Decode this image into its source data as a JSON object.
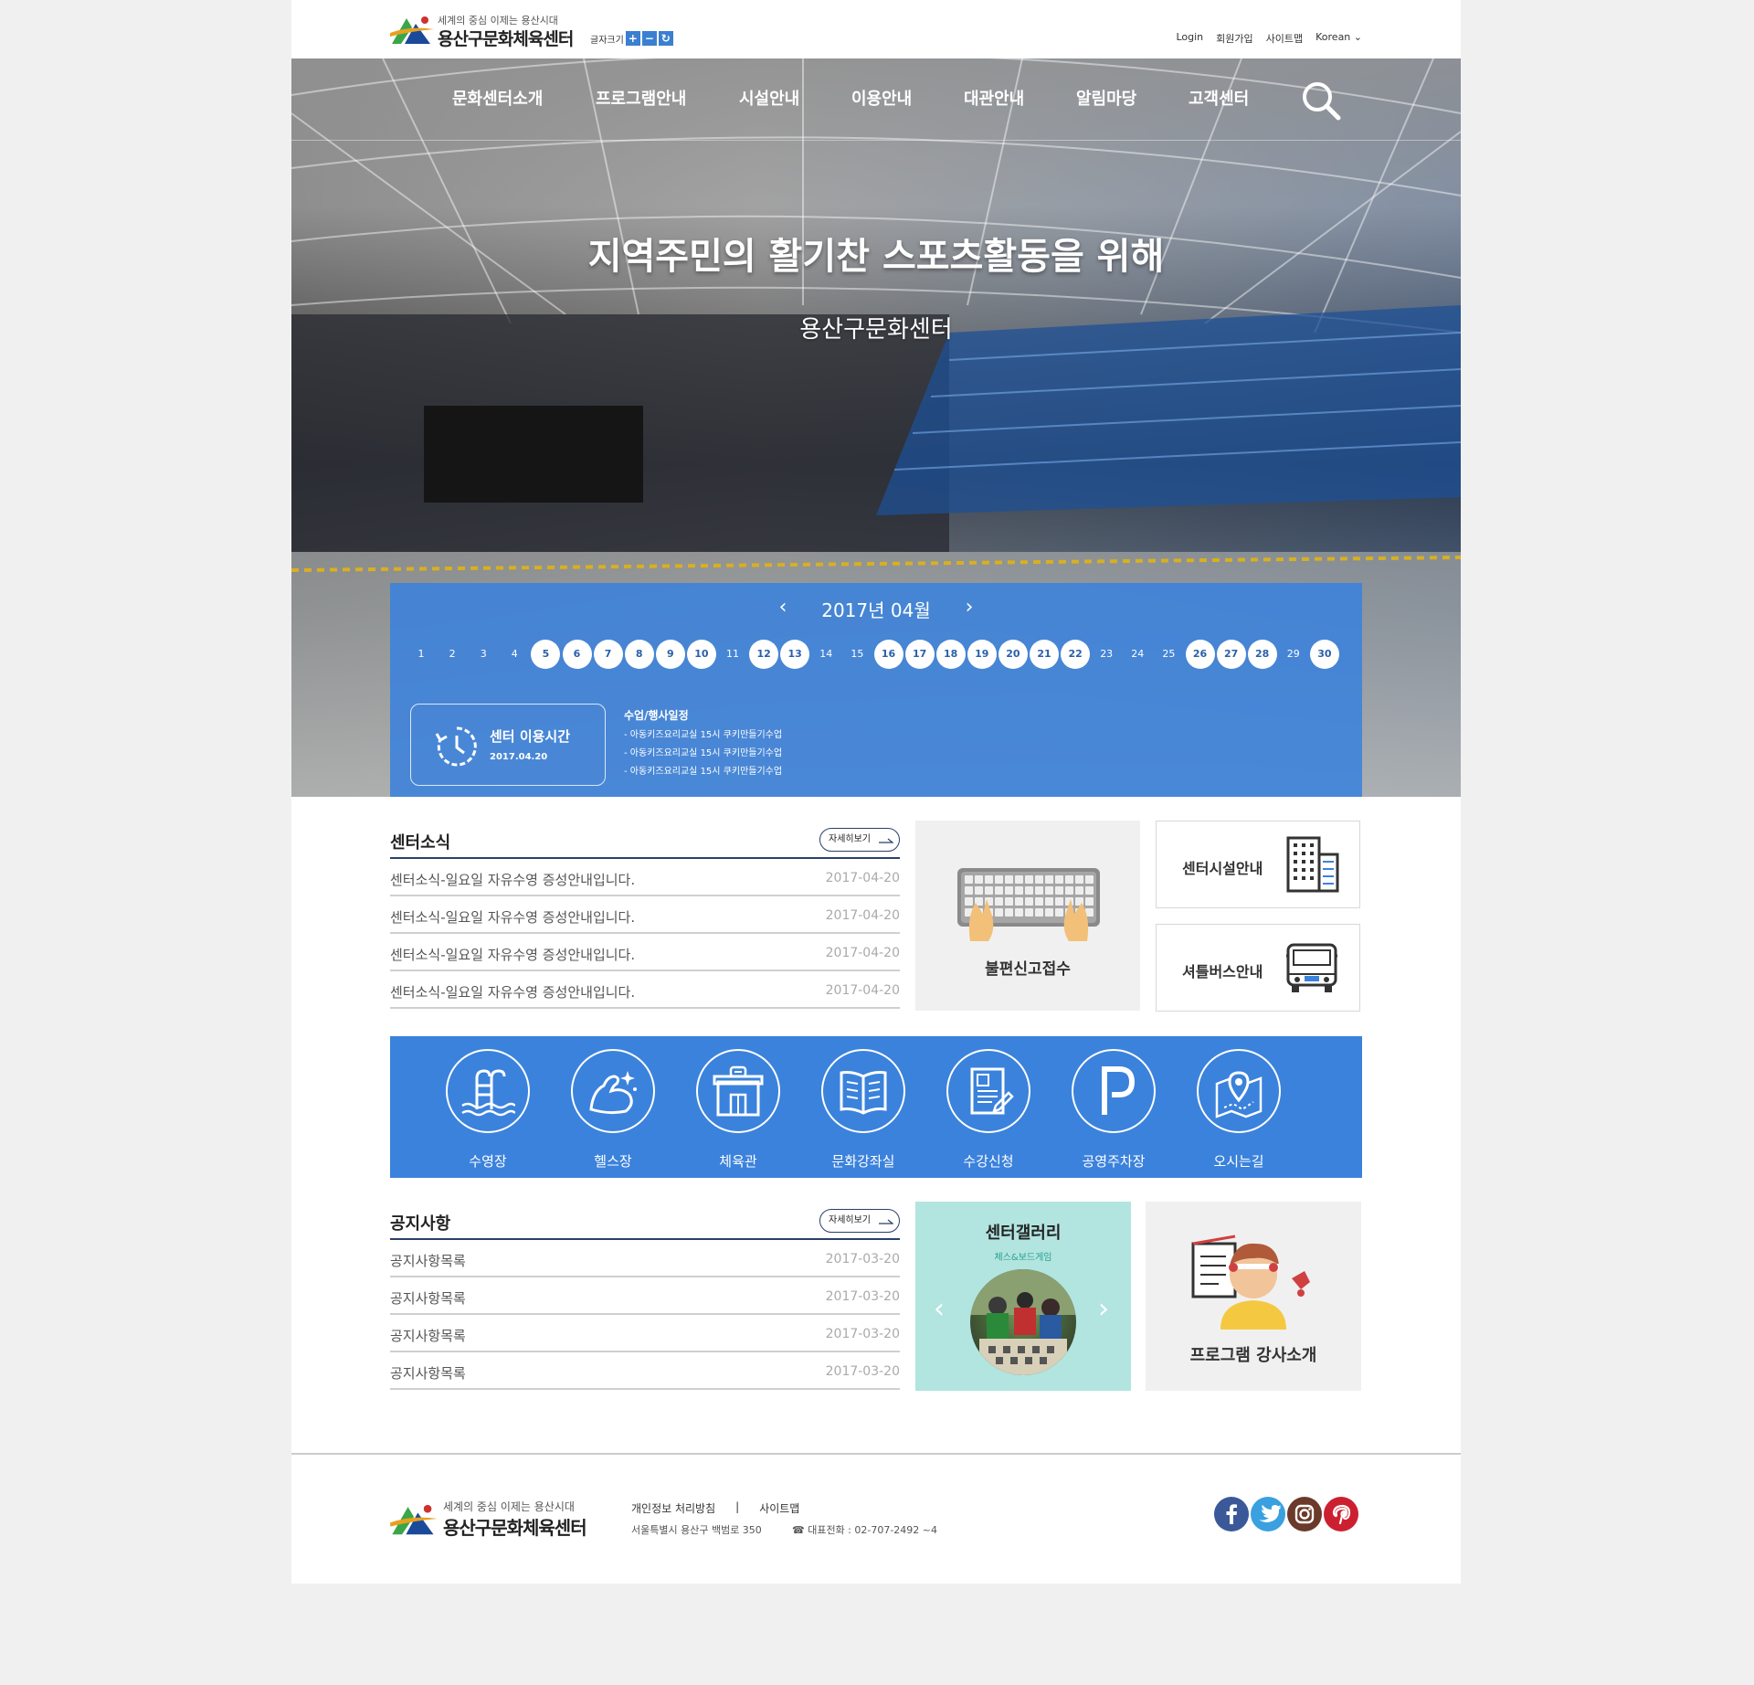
{
  "header": {
    "logo_tagline": "세계의 중심 이제는 용산시대",
    "logo_name": "용산구문화체육센터",
    "font_size_label": "글자크기",
    "font_plus": "+",
    "font_minus": "−",
    "font_reset": "↻",
    "util": {
      "login": "Login",
      "join": "회원가입",
      "sitemap": "사이트맵",
      "language": "Korean ⌄"
    }
  },
  "nav": [
    "문화센터소개",
    "프로그램안내",
    "시설안내",
    "이용안내",
    "대관안내",
    "알림마당",
    "고객센터"
  ],
  "hero": {
    "title": "지역주민의 활기찬 스포츠활동을 위해",
    "subtitle": "용산구문화센터"
  },
  "calendar": {
    "month": "2017년 04월",
    "prev": "‹",
    "next": "›",
    "days": [
      "1",
      "2",
      "3",
      "4",
      "5",
      "6",
      "7",
      "8",
      "9",
      "10",
      "11",
      "12",
      "13",
      "14",
      "15",
      "16",
      "17",
      "18",
      "19",
      "20",
      "21",
      "22",
      "23",
      "24",
      "25",
      "26",
      "27",
      "28",
      "29",
      "30"
    ],
    "highlighted": [
      "5",
      "6",
      "7",
      "8",
      "9",
      "10",
      "12",
      "13",
      "16",
      "17",
      "18",
      "19",
      "20",
      "21",
      "22",
      "26",
      "27",
      "28",
      "30"
    ],
    "hours_title": "센터 이용시간",
    "hours_date": "2017.04.20",
    "schedule_title": "수업/행사일정",
    "schedule": [
      "- 아동키즈요리교실  15시  쿠키만들기수업",
      "- 아동키즈요리교실  15시  쿠키만들기수업",
      "- 아동키즈요리교실  15시  쿠키만들기수업"
    ]
  },
  "news": {
    "title": "센터소식",
    "more": "자세히보기",
    "items": [
      {
        "text": "센터소식-일요일 자유수영 증성안내입니다.",
        "date": "2017-04-20"
      },
      {
        "text": "센터소식-일요일 자유수영 증성안내입니다.",
        "date": "2017-04-20"
      },
      {
        "text": "센터소식-일요일 자유수영 증성안내입니다.",
        "date": "2017-04-20"
      },
      {
        "text": "센터소식-일요일 자유수영 증성안내입니다.",
        "date": "2017-04-20"
      }
    ]
  },
  "complaint": {
    "label": "불편신고접수"
  },
  "quick": {
    "facility": "센터시설안내",
    "shuttle": "셔틀버스안내"
  },
  "facilities": [
    {
      "label": "수영장",
      "icon": "pool-ladder-icon"
    },
    {
      "label": "헬스장",
      "icon": "muscle-arm-icon"
    },
    {
      "label": "체육관",
      "icon": "gym-building-icon"
    },
    {
      "label": "문화강좌실",
      "icon": "open-book-icon"
    },
    {
      "label": "수강신청",
      "icon": "application-form-icon"
    },
    {
      "label": "공영주차장",
      "icon": "parking-icon"
    },
    {
      "label": "오시는길",
      "icon": "map-pin-icon"
    }
  ],
  "notice": {
    "title": "공지사항",
    "more": "자세히보기",
    "items": [
      {
        "text": "공지사항목록",
        "date": "2017-03-20"
      },
      {
        "text": "공지사항목록",
        "date": "2017-03-20"
      },
      {
        "text": "공지사항목록",
        "date": "2017-03-20"
      },
      {
        "text": "공지사항목록",
        "date": "2017-03-20"
      }
    ]
  },
  "gallery": {
    "title": "센터갤러리",
    "subtitle": "체스&보드게임",
    "prev": "‹",
    "next": "›"
  },
  "instructor": {
    "label": "프로그램 강사소개"
  },
  "footer": {
    "logo_tagline": "세계의 중심 이제는 용산시대",
    "logo_name": "용산구문화체육센터",
    "privacy": "개인정보 처리방침",
    "separator": "|",
    "sitemap": "사이트맵",
    "address": "서울특별시 용산구 백범로 350",
    "phone": "☎ 대표전화 : 02-707-2492 ~4"
  },
  "social": [
    "facebook-icon",
    "twitter-icon",
    "instagram-icon",
    "pinterest-icon"
  ],
  "colors": {
    "accent_blue": "#3b82dc",
    "navy": "#2a3f6a"
  }
}
